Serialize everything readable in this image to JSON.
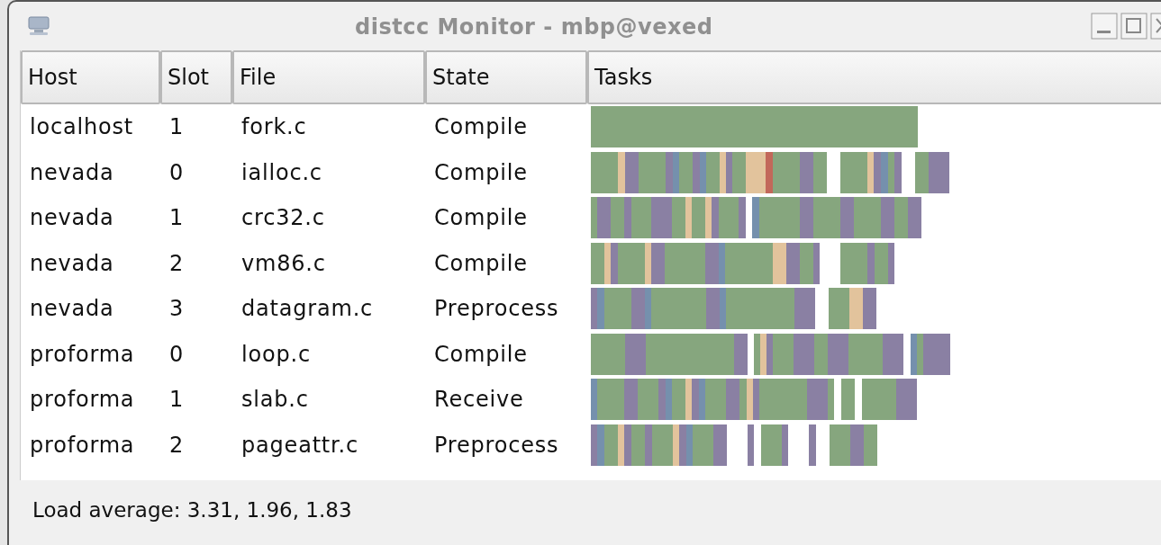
{
  "window": {
    "title": "distcc Monitor - mbp@vexed"
  },
  "table": {
    "columns": [
      "Host",
      "Slot",
      "File",
      "State",
      "Tasks"
    ],
    "rows": [
      {
        "host": "localhost",
        "slot": "1",
        "file": "fork.c",
        "state": "Compile"
      },
      {
        "host": "nevada",
        "slot": "0",
        "file": "ialloc.c",
        "state": "Compile"
      },
      {
        "host": "nevada",
        "slot": "1",
        "file": "crc32.c",
        "state": "Compile"
      },
      {
        "host": "nevada",
        "slot": "2",
        "file": "vm86.c",
        "state": "Compile"
      },
      {
        "host": "nevada",
        "slot": "3",
        "file": "datagram.c",
        "state": "Preprocess"
      },
      {
        "host": "proforma",
        "slot": "0",
        "file": "loop.c",
        "state": "Compile"
      },
      {
        "host": "proforma",
        "slot": "1",
        "file": "slab.c",
        "state": "Receive"
      },
      {
        "host": "proforma",
        "slot": "2",
        "file": "pageattr.c",
        "state": "Preprocess"
      }
    ]
  },
  "status_bar": {
    "text": "Load average: 3.31, 1.96, 1.83"
  }
}
